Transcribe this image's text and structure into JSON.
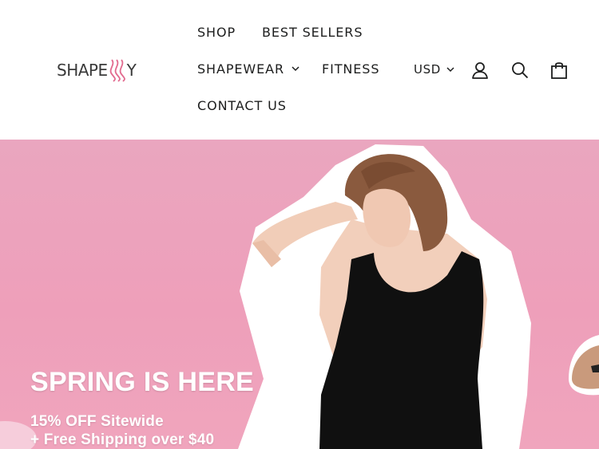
{
  "brand": {
    "logo_left": "SHAPE",
    "logo_right": "Y",
    "logo_mark_color": "#e26b8f"
  },
  "nav": {
    "items": [
      {
        "label": "SHOP"
      },
      {
        "label": "BEST SELLERS"
      },
      {
        "label": "SHAPEWEAR",
        "has_dropdown": true
      },
      {
        "label": "FITNESS"
      },
      {
        "label": "CONTACT US"
      }
    ]
  },
  "header_tools": {
    "currency": "USD",
    "icons": [
      "account-icon",
      "search-icon",
      "cart-icon"
    ]
  },
  "hero": {
    "title": "SPRING IS HERE",
    "line1": "15% OFF Sitewide",
    "line2": "+ Free Shipping over $40",
    "background_color": "#ee9fba",
    "text_color": "#ffffff"
  }
}
